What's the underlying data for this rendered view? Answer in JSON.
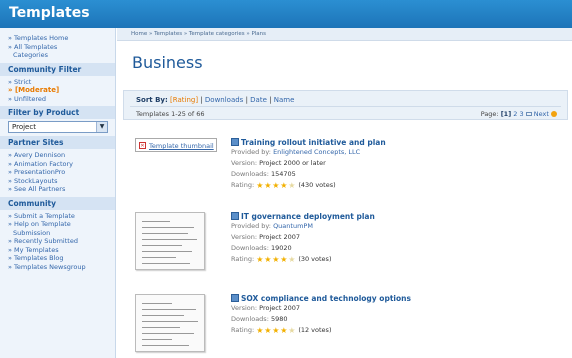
{
  "app": {
    "title": "Templates"
  },
  "sidebar": {
    "nav": [
      {
        "label": "» Templates Home"
      },
      {
        "label": "» All Templates"
      },
      {
        "label": "Categories"
      }
    ],
    "community_filter": {
      "heading": "Community Filter",
      "items": [
        {
          "label": "» Strict"
        },
        {
          "label": "» [Moderate]"
        },
        {
          "label": "» Unfiltered"
        }
      ]
    },
    "filter_by_product": {
      "heading": "Filter by Product",
      "selected": "Project"
    },
    "partner_sites": {
      "heading": "Partner Sites",
      "items": [
        {
          "label": "» Avery Dennison"
        },
        {
          "label": "» Animation Factory"
        },
        {
          "label": "» PresentationPro"
        },
        {
          "label": "» StockLayouts"
        },
        {
          "label": "» See All Partners"
        }
      ]
    },
    "community": {
      "heading": "Community",
      "items": [
        {
          "label": "» Submit a Template"
        },
        {
          "label": "» Help on Template"
        },
        {
          "label": "Submission"
        },
        {
          "label": "» Recently Submitted"
        },
        {
          "label": "» My Templates"
        },
        {
          "label": "» Templates Blog"
        },
        {
          "label": "» Templates Newsgroup"
        }
      ]
    }
  },
  "breadcrumb": "Home » Templates » Template categories » Plans",
  "page_title": "Business",
  "sort": {
    "label": "Sort By:",
    "options": [
      "[Rating]",
      "Downloads",
      "Date",
      "Name"
    ],
    "separator": " | "
  },
  "results_count": "Templates 1-25 of 66",
  "pager": {
    "label": "Page:",
    "current": "[1]",
    "pages": [
      "2",
      "3"
    ],
    "next": "Next"
  },
  "results": [
    {
      "title": "Training rollout initiative and plan",
      "thumbnail_label": "Template thumbnail",
      "provided_by_label": "Provided by:",
      "provider": "Enlightened Concepts, LLC",
      "version_label": "Version:",
      "version": "Project 2000 or later",
      "downloads_label": "Downloads:",
      "downloads": "154705",
      "rating_label": "Rating:",
      "rating": 4,
      "votes": "(430 votes)"
    },
    {
      "title": "IT governance deployment plan",
      "provided_by_label": "Provided by:",
      "provider": "QuantumPM",
      "version_label": "Version:",
      "version": "Project 2007",
      "downloads_label": "Downloads:",
      "downloads": "19020",
      "rating_label": "Rating:",
      "rating": 4,
      "votes": "(30 votes)"
    },
    {
      "title": "SOX compliance and technology options",
      "version_label": "Version:",
      "version": "Project 2007",
      "downloads_label": "Downloads:",
      "downloads": "5980",
      "rating_label": "Rating:",
      "rating": 4,
      "votes": "(12 votes)"
    }
  ]
}
